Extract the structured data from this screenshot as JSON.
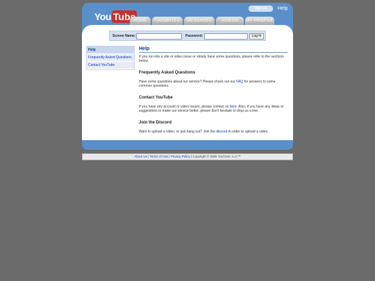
{
  "logo": {
    "you": "You",
    "tube": "Tube"
  },
  "header": {
    "signup_label": "Sign Up",
    "help_label": "Help"
  },
  "tabs": [
    {
      "label": "HOME"
    },
    {
      "label": "FAVORITES"
    },
    {
      "label": "MESSAGES"
    },
    {
      "label": "VIDEOS"
    },
    {
      "label": "MY PROFILE"
    }
  ],
  "login": {
    "screen_name_label": "Screen Name:",
    "password_label": "Password:",
    "screen_name_value": "",
    "password_value": "",
    "button_label": "Log In"
  },
  "sidebar": {
    "items": [
      {
        "label": "Help"
      },
      {
        "label": "Frequently Asked Questions"
      },
      {
        "label": "Contact YouTube"
      }
    ]
  },
  "main": {
    "title": "Help",
    "intro": "If you run into a site or video issue or simply have some questions, please refer to the sections below.",
    "faq_heading": "Frequently Asked Questions",
    "faq_text_1": "Have some questions about our service? Please check out our ",
    "faq_link": "FAQ",
    "faq_text_2": " for answers to some common questions.",
    "contact_heading": "Contact YouTube",
    "contact_text_1": "If you have any account or video issues, please contact us ",
    "contact_link": "here",
    "contact_text_2": ". Also, if you have any ideas or suggestions to make our service better, please don't hesitate to drop us a line.",
    "discord_heading": "Join the Discord",
    "discord_text_1": "Want to upload a video, or just hang out? Join the ",
    "discord_link": "discord",
    "discord_text_2": " in order to upload a video."
  },
  "footer": {
    "about_label": "About Us",
    "sep": " | ",
    "terms_label": "Terms of Use",
    "privacy_label": "Privacy Policy",
    "copyright": " | Copyright © 2005 YouTube, LLC™"
  },
  "colors": {
    "background": "#6b6b6b",
    "header_blue": "#5b8fca",
    "link_blue": "#0033cc",
    "logo_red": "#c4302b"
  }
}
